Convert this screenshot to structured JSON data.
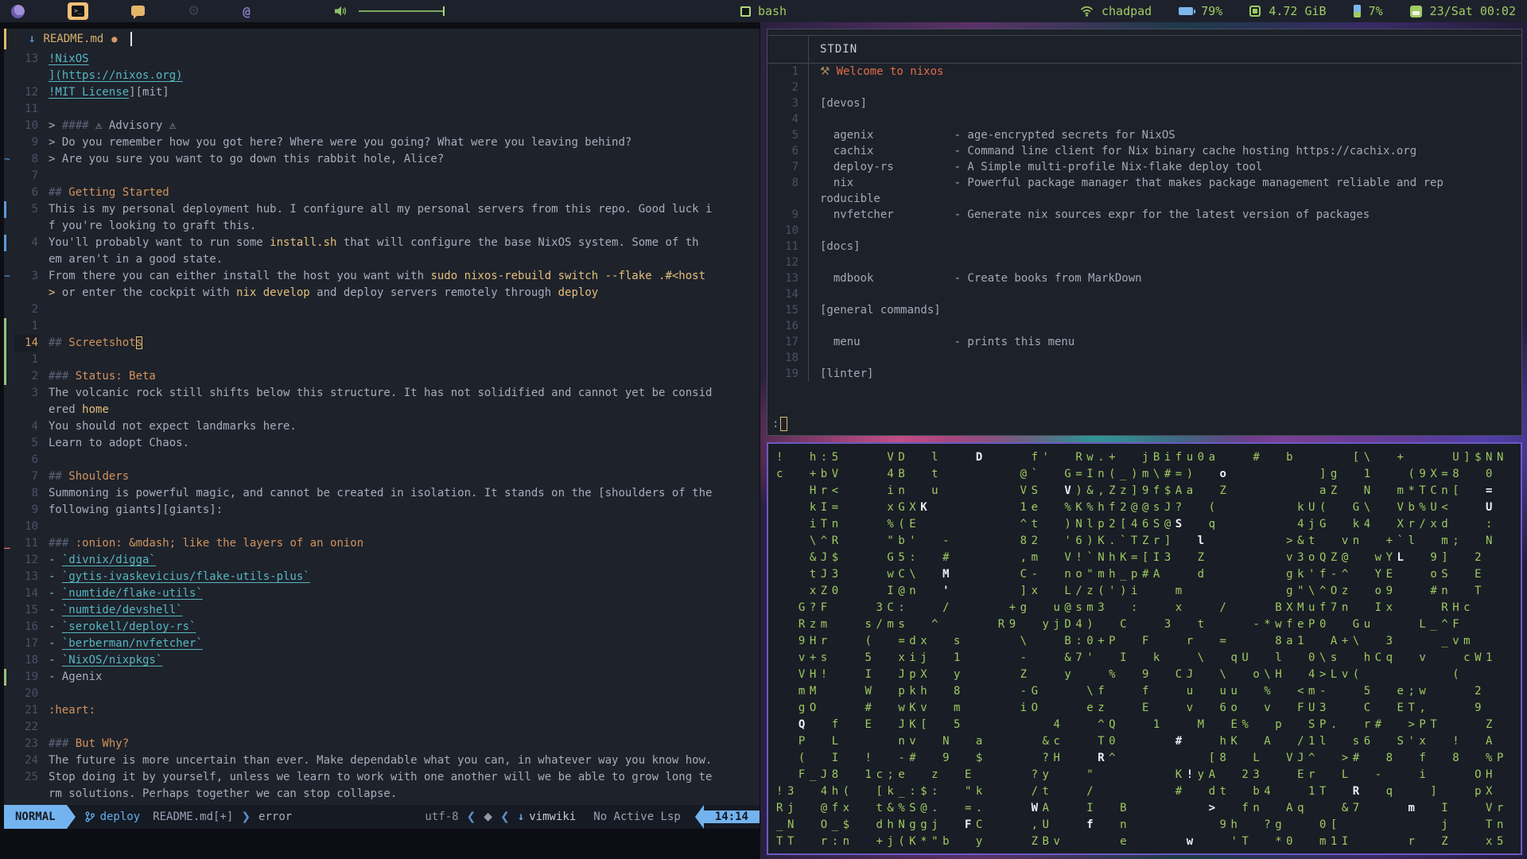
{
  "colors": {
    "bar_green": "#9fcb64",
    "bar_blue": "#7db7ec",
    "bar_yellow": "#f0c078",
    "bar_purple": "#8d7ac6",
    "accent_blue": "#61afef",
    "heading_orange": "#d1935c",
    "code_yellow": "#e3bf7a",
    "link_cyan": "#56b6c2",
    "matrix_green": "#9dca60",
    "chip_blue": "#73b3ef",
    "welcome_orange": "#e06c4a"
  },
  "topbar": {
    "window_title": "bash",
    "launcher_icons": [
      "firefox-icon",
      "terminal-icon",
      "chat-icon",
      "gear-icon",
      "at-icon",
      "volume-icon"
    ],
    "status": {
      "host": "chadpad",
      "battery": "79%",
      "memory": "4.72 GiB",
      "cpu": "7%",
      "clock": "23/Sat 00:02"
    }
  },
  "editor": {
    "tab": {
      "filename": "README.md",
      "modified_dot": "●",
      "filetype_icon": "markdown-icon"
    },
    "status": {
      "mode": "NORMAL",
      "branch": "deploy",
      "file": "README.md[+]",
      "diagnostic": "error",
      "encoding": "utf-8",
      "filetype": "vimwiki",
      "lsp": "No Active Lsp",
      "time": "14:14",
      "sep_right": "❯",
      "sep_left": "❮",
      "ft_arrow": "↓",
      "vim_icon": "◆"
    },
    "rows": [
      {
        "n": "13",
        "s": [
          {
            "t": "!NixOS",
            "c": "link"
          }
        ]
      },
      {
        "n": "",
        "s": [
          {
            "t": "](https://nixos.org)",
            "c": "link"
          }
        ]
      },
      {
        "n": "12",
        "s": [
          {
            "t": "!MIT License",
            "c": "link"
          },
          {
            "t": "][mit]",
            "c": "fg"
          }
        ]
      },
      {
        "n": "11",
        "s": []
      },
      {
        "n": "10",
        "s": [
          {
            "t": "> ",
            "c": "fg"
          },
          {
            "t": "#### ",
            "c": "gray"
          },
          {
            "t": "⚠ Advisory ⚠",
            "c": "fg"
          }
        ]
      },
      {
        "n": "9",
        "s": [
          {
            "t": "> Do you remember how you got here? Where were you going? What were you leaving behind?",
            "c": "fg"
          }
        ]
      },
      {
        "n": "8",
        "sign": "tilde",
        "s": [
          {
            "t": "> Are you sure you want to go down this rabbit hole, Alice?",
            "c": "fg"
          }
        ]
      },
      {
        "n": "7",
        "s": []
      },
      {
        "n": "6",
        "s": [
          {
            "t": "## ",
            "c": "gray"
          },
          {
            "t": "Getting Started",
            "c": "orange"
          }
        ]
      },
      {
        "n": "5",
        "sign": "bar-blue",
        "s": [
          {
            "t": "This is my personal deployment hub. I configure all my personal servers from this repo. Good luck i",
            "c": "fg"
          }
        ]
      },
      {
        "n": "",
        "s": [
          {
            "t": "f you're looking to graft this.",
            "c": "fg"
          }
        ]
      },
      {
        "n": "4",
        "sign": "bar-blue",
        "s": [
          {
            "t": "You'll probably want to run some ",
            "c": "fg"
          },
          {
            "t": "install.sh",
            "c": "yellow"
          },
          {
            "t": " that will configure the base NixOS system. Some of th",
            "c": "fg"
          }
        ]
      },
      {
        "n": "",
        "s": [
          {
            "t": "em aren't in a good state.",
            "c": "fg"
          }
        ]
      },
      {
        "n": "3",
        "sign": "tilde",
        "s": [
          {
            "t": "From there you can either install the host you want with ",
            "c": "fg"
          },
          {
            "t": "sudo nixos-rebuild switch --flake .#<host",
            "c": "yellow"
          }
        ]
      },
      {
        "n": "",
        "s": [
          {
            "t": ">",
            "c": "yellow"
          },
          {
            "t": " or enter the cockpit with ",
            "c": "fg"
          },
          {
            "t": "nix develop",
            "c": "yellow"
          },
          {
            "t": " and deploy servers remotely through ",
            "c": "fg"
          },
          {
            "t": "deploy",
            "c": "yellow"
          }
        ]
      },
      {
        "n": "2",
        "s": []
      },
      {
        "n": "1",
        "sign": "bar-green",
        "s": []
      },
      {
        "n": "14",
        "cur": true,
        "sign": "bar-green",
        "s": [
          {
            "t": "## ",
            "c": "gray"
          },
          {
            "t": "Screetshot",
            "c": "orange"
          },
          {
            "t": "s",
            "c": "orange cursor"
          }
        ]
      },
      {
        "n": "1",
        "sign": "bar-green",
        "s": []
      },
      {
        "n": "2",
        "sign": "bar-green",
        "s": [
          {
            "t": "### ",
            "c": "gray"
          },
          {
            "t": "Status: Beta",
            "c": "orange"
          }
        ]
      },
      {
        "n": "3",
        "s": [
          {
            "t": "The volcanic rock still shifts below this structure. It has not solidified and cannot yet be consid",
            "c": "fg"
          }
        ]
      },
      {
        "n": "",
        "s": [
          {
            "t": "ered ",
            "c": "fg"
          },
          {
            "t": "home",
            "c": "yellow"
          }
        ]
      },
      {
        "n": "4",
        "s": [
          {
            "t": "You should not expect landmarks here.",
            "c": "fg"
          }
        ]
      },
      {
        "n": "5",
        "s": [
          {
            "t": "Learn to adopt Chaos.",
            "c": "fg"
          }
        ]
      },
      {
        "n": "6",
        "s": []
      },
      {
        "n": "7",
        "s": [
          {
            "t": "## ",
            "c": "gray"
          },
          {
            "t": "Shoulders",
            "c": "orange"
          }
        ]
      },
      {
        "n": "8",
        "s": [
          {
            "t": "Summoning is powerful magic, and cannot be created in isolation. It stands on the [shoulders of the",
            "c": "fg"
          }
        ]
      },
      {
        "n": "9",
        "s": [
          {
            "t": "following giants][giants]:",
            "c": "fg"
          }
        ]
      },
      {
        "n": "10",
        "s": []
      },
      {
        "n": "11",
        "sign": "dash-red",
        "s": [
          {
            "t": "### ",
            "c": "gray"
          },
          {
            "t": ":onion: &mdash; like the layers of an onion",
            "c": "orange"
          }
        ]
      },
      {
        "n": "12",
        "s": [
          {
            "t": "- ",
            "c": "fg"
          },
          {
            "t": "`divnix/digga`",
            "c": "link"
          }
        ]
      },
      {
        "n": "13",
        "s": [
          {
            "t": "- ",
            "c": "fg"
          },
          {
            "t": "`gytis-ivaskevicius/flake-utils-plus`",
            "c": "link"
          }
        ]
      },
      {
        "n": "14",
        "s": [
          {
            "t": "- ",
            "c": "fg"
          },
          {
            "t": "`numtide/flake-utils`",
            "c": "link"
          }
        ]
      },
      {
        "n": "15",
        "s": [
          {
            "t": "- ",
            "c": "fg"
          },
          {
            "t": "`numtide/devshell`",
            "c": "link"
          }
        ]
      },
      {
        "n": "16",
        "s": [
          {
            "t": "- ",
            "c": "fg"
          },
          {
            "t": "`serokell/deploy-rs`",
            "c": "link"
          }
        ]
      },
      {
        "n": "17",
        "s": [
          {
            "t": "- ",
            "c": "fg"
          },
          {
            "t": "`berberman/nvfetcher`",
            "c": "link"
          }
        ]
      },
      {
        "n": "18",
        "s": [
          {
            "t": "- ",
            "c": "fg"
          },
          {
            "t": "`NixOS/nixpkgs`",
            "c": "link"
          }
        ]
      },
      {
        "n": "19",
        "sign": "bar-green",
        "s": [
          {
            "t": "- Agenix",
            "c": "fg"
          }
        ]
      },
      {
        "n": "20",
        "s": []
      },
      {
        "n": "21",
        "s": [
          {
            "t": ":heart:",
            "c": "orange"
          }
        ]
      },
      {
        "n": "22",
        "s": []
      },
      {
        "n": "23",
        "s": [
          {
            "t": "### ",
            "c": "gray"
          },
          {
            "t": "But Why?",
            "c": "orange"
          }
        ]
      },
      {
        "n": "24",
        "s": [
          {
            "t": "The future is more uncertain than ever. Make dependable what you can, in whatever way you know how.",
            "c": "fg"
          }
        ]
      },
      {
        "n": "25",
        "s": [
          {
            "t": "Stop doing it by yourself, unless we learn to work with one another will we be able to grow long te",
            "c": "fg"
          }
        ]
      },
      {
        "n": "",
        "s": [
          {
            "t": "rm solutions. Perhaps together we can stop collapse.",
            "c": "fg"
          }
        ]
      }
    ]
  },
  "pager": {
    "header": "STDIN",
    "prompt": ":",
    "lines": [
      {
        "n": "1",
        "icon": true,
        "t": "Welcome to nixos",
        "c": "accent"
      },
      {
        "n": "2",
        "t": ""
      },
      {
        "n": "3",
        "t": "[devos]"
      },
      {
        "n": "4",
        "t": ""
      },
      {
        "n": "5",
        "t": "  agenix            - age-encrypted secrets for NixOS"
      },
      {
        "n": "6",
        "t": "  cachix            - Command line client for Nix binary cache hosting https://cachix.org"
      },
      {
        "n": "7",
        "t": "  deploy-rs         - A Simple multi-profile Nix-flake deploy tool"
      },
      {
        "n": "8",
        "t": "  nix               - Powerful package manager that makes package management reliable and rep"
      },
      {
        "n": "",
        "t": "roducible"
      },
      {
        "n": "9",
        "t": "  nvfetcher         - Generate nix sources expr for the latest version of packages"
      },
      {
        "n": "10",
        "t": ""
      },
      {
        "n": "11",
        "t": "[docs]"
      },
      {
        "n": "12",
        "t": ""
      },
      {
        "n": "13",
        "t": "  mdbook            - Create books from MarkDown"
      },
      {
        "n": "14",
        "t": ""
      },
      {
        "n": "15",
        "t": "[general commands]"
      },
      {
        "n": "16",
        "t": ""
      },
      {
        "n": "17",
        "t": "  menu              - prints this menu"
      },
      {
        "n": "18",
        "t": ""
      },
      {
        "n": "19",
        "t": "[linter]"
      }
    ]
  },
  "matrix": {
    "rows": [
      "!  h:5    VD  l   D    f'  Rw.+  jBifu0a   #  b     [\\  +    U]$NN",
      "c  +bV    4B  t       @`  G=In(_)m\\#=)  o        ]g  1   (9X=8  0",
      "   Hr<    in  u       VS  V)&,Zz]9f$Aa  Z        aZ  N  m*TCn[  =",
      "   kI=    xGXK        1e  %K%hf2@@sJ?  (       kU(  G\\  Vb%U<   U",
      "   iTn    %(E         ^t  )Nlp2[46S@S  q       4jG  k4  Xr/xd   :",
      "   \\^R    \"b'  -      82  '6)K.`TZr]  l       >&t  vn  +`l  m;  N",
      "   &J$    G5:  #      ,m  V!`NhK=[I3  Z       v3oQZ@  wYL  9]  2",
      "   tJ3    wC\\  M      C-  no\"mh_p#A   d       gk'f-^  YE   oS  E",
      "   xZ0    I@n  '      ]x  L/z(')i   m         g\"\\^Oz  o9   #n  T",
      "  G?F    3C:   /     +g  u@sm3  :   x   /    BXMuf7n  Ix    RHc",
      "  Rzm   s/ms  ^     R9  yjD4)  C   3  t    -*wfeP0  Gu    L_^F",
      "  9Hr   (  =dx  s     \\   B:0+P  F   r  =    8a1  A+\\  3    _vm",
      "  v+s   5  xij  1     -   &7'  I  k   \\  qU  l  0\\s  hCq  v   cW1",
      "  VH!   I  JpX  y     Z   y   %  9  CJ  \\  o\\H  4>Lv(        (",
      "  mM    W  pkh  8     -G    \\f   f   u  uu  %  <m-   5  e;w    2",
      "  gO    #  wKv  m     iO    ez   E   v  6o  v  FU3   C  ET,    9",
      "  Q  f  E  JK[  5        4   ^Q   1   M  E%  p  SP.  r#  >PT    Z",
      "  P  L     nv  N  a     &c   T0     #   hK  A  /1l  s6  S'x  !  A",
      "  (  I  !  -#  9  $     ?H   R^        [8  L  VJ^  >#  8  f  8  %P",
      "  F_J8  1c;e  z  E     ?y   \"       K!yA  23   Er  L  -   i    OH",
      "!3  4h(  [k_:$:  \"k    /t   /       #  dt  b4   1T  R  q   ]   pX",
      "Rj  @fx  t&%S@.  =.    WA   I  B       >  fn  Aq   &7    m  I   Vr",
      "_N  O_$  dhNggj  FC    ,U   f  n        9h  ?g   0[         j   Tn",
      "TT  r:n  +j(K*\"b  y    ZBv     e     w   'T  *0  m1I     r  Z   x5"
    ],
    "highlights": [
      [
        0,
        18
      ],
      [
        1,
        40
      ],
      [
        2,
        26
      ],
      [
        2,
        64
      ],
      [
        3,
        13
      ],
      [
        3,
        64
      ],
      [
        4,
        36
      ],
      [
        5,
        38
      ],
      [
        6,
        56
      ],
      [
        7,
        15
      ],
      [
        8,
        15
      ],
      [
        16,
        2
      ],
      [
        17,
        36
      ],
      [
        18,
        29
      ],
      [
        19,
        37
      ],
      [
        20,
        52
      ],
      [
        21,
        23
      ],
      [
        21,
        39
      ],
      [
        21,
        57
      ],
      [
        22,
        17
      ],
      [
        22,
        28
      ],
      [
        23,
        37
      ]
    ]
  }
}
